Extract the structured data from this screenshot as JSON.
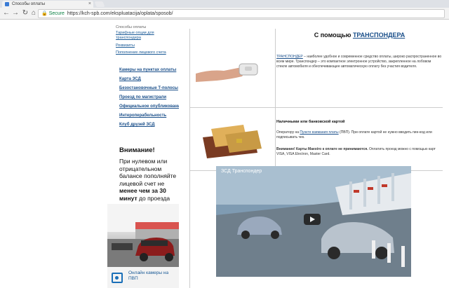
{
  "browser": {
    "tab_title": "Способы оплаты",
    "secure_label": "Secure",
    "url": "https://kch-spb.com/ekspluatacija/oplata/sposob/"
  },
  "sidebar": {
    "sub_title": "Способы оплаты",
    "sub_items": [
      {
        "label": "Тарифные опции для транспондера"
      },
      {
        "label": "Реквизиты"
      },
      {
        "label": "Пополнение лицевого счета"
      }
    ],
    "main_links": [
      {
        "label": "Камеры на пунктах оплаты"
      },
      {
        "label": "Карта ЗСД"
      },
      {
        "label": "Безостановочные Т-полосы"
      },
      {
        "label": "Проезд по магистрали"
      },
      {
        "label": "Официальное опубликование"
      },
      {
        "label": "Интероперабельность"
      },
      {
        "label": "Клуб друзей ЗСД"
      }
    ],
    "attention": {
      "title": "Внимание!",
      "text_1": "При нулевом или отрицательном балансе пополняйте лицевой счет не",
      "text_bold": "менее чем за 30 минут",
      "text_2": "до проезда пункта оплаты"
    },
    "promo_caption": "Онлайн камеры на ПВП"
  },
  "content": {
    "heading_prefix": "С помощью",
    "heading_link": "ТРАНСПОНДЕРА",
    "transponder_link": "ТРАНСПОНДЕР",
    "transponder_text": "– наиболее удобное и современное средство оплаты, широко распространенное во всем мире. Транспондер – это компактное электронное устройство, закрепленное на лобовом стекле автомобиля и обеспечивающее автоматическую оплату без участия водителя.",
    "cash_title": "Наличными или банковской картой",
    "cash_text_1": "Оператору на",
    "cash_link": "Пункте взимания платы",
    "cash_text_2": "(ПВП). При оплате картой не нужно вводить пин-код или подписывать чек.",
    "warning_bold": "Внимание! Карты Maestro к оплате не принимаются.",
    "warning_text": "Оплатить проезд можно с помощью карт VISA, VISA Electron, Master Card."
  },
  "video": {
    "title": "ЗСД Транспондер"
  }
}
